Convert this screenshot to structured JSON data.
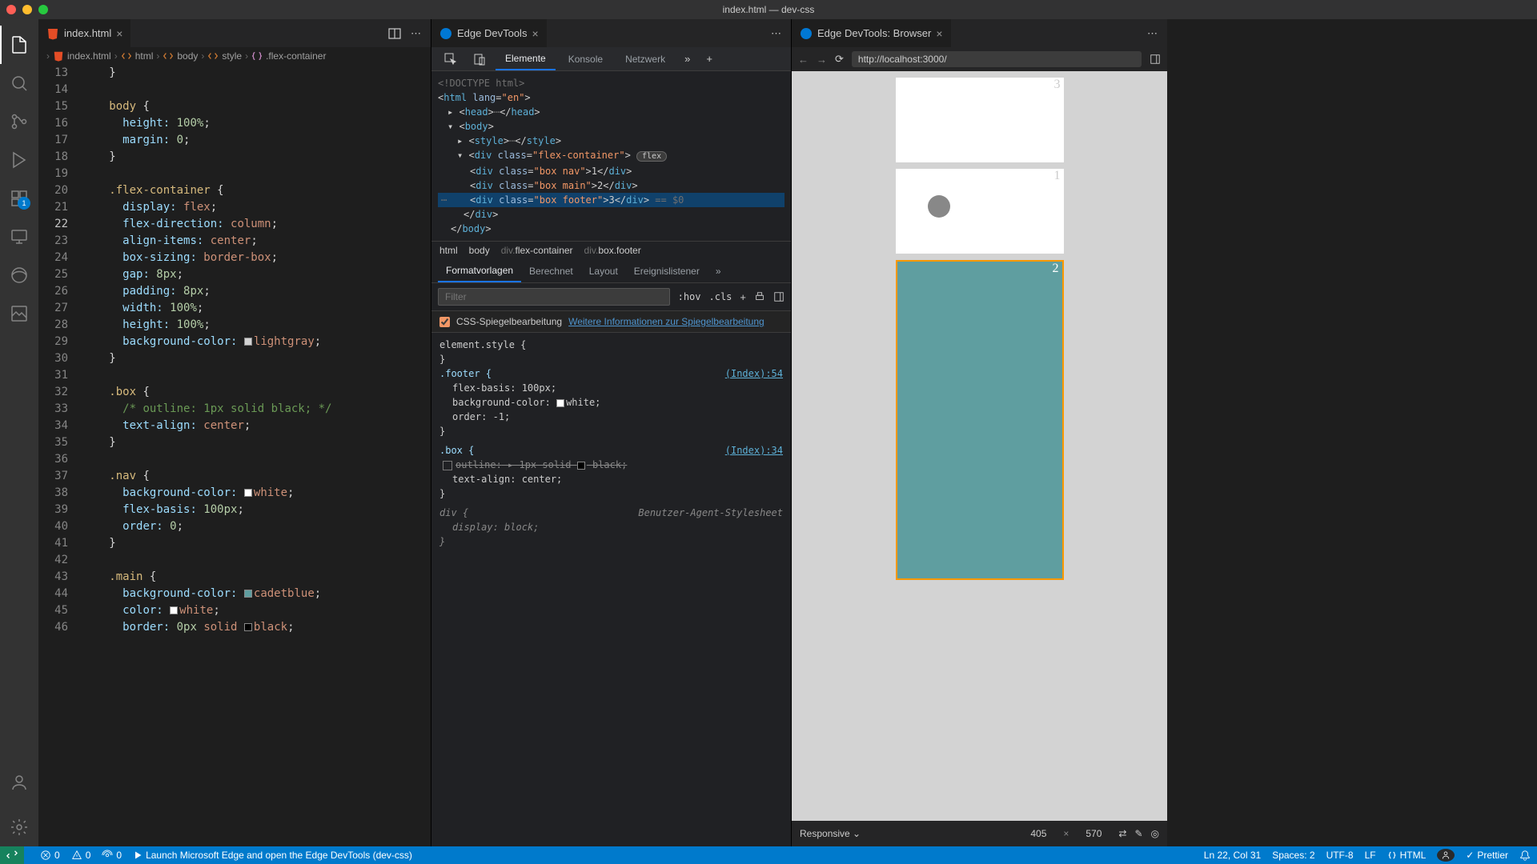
{
  "window_title": "index.html — dev-css",
  "editor": {
    "tab": {
      "name": "index.html"
    },
    "breadcrumbs": [
      "index.html",
      "html",
      "body",
      "style",
      ".flex-container"
    ],
    "line_numbers": [
      "13",
      "14",
      "15",
      "16",
      "17",
      "18",
      "19",
      "20",
      "21",
      "22",
      "23",
      "24",
      "25",
      "26",
      "27",
      "28",
      "29",
      "30",
      "31",
      "32",
      "33",
      "34",
      "35",
      "36",
      "37",
      "38",
      "39",
      "40",
      "41",
      "42",
      "43",
      "44",
      "45",
      "46"
    ],
    "highlighted_line": "22"
  },
  "code": {
    "l13": "}",
    "l15_sel": "body",
    "l15_brace": " {",
    "l16_p": "height:",
    "l16_v": " 100%",
    "l16_sc": ";",
    "l17_p": "margin:",
    "l17_v": " 0",
    "l17_sc": ";",
    "l18": "}",
    "l20_sel": ".flex-container",
    "l20_brace": " {",
    "l21_p": "display:",
    "l21_v": " flex",
    "l21_sc": ";",
    "l22_p": "flex-direction:",
    "l22_v": " column",
    "l22_sc": ";",
    "l23_p": "align-items:",
    "l23_v": " center",
    "l23_sc": ";",
    "l24_p": "box-sizing:",
    "l24_v": " border-box",
    "l24_sc": ";",
    "l25_p": "gap:",
    "l25_v": " 8px",
    "l25_sc": ";",
    "l26_p": "padding:",
    "l26_v": " 8px",
    "l26_sc": ";",
    "l27_p": "width:",
    "l27_v": " 100%",
    "l27_sc": ";",
    "l28_p": "height:",
    "l28_v": " 100%",
    "l28_sc": ";",
    "l29_p": "background-color:",
    "l29_v": "lightgray",
    "l29_sc": ";",
    "l30": "}",
    "l32_sel": ".box",
    "l32_brace": " {",
    "l33_c": "/* outline: 1px solid black; */",
    "l34_p": "text-align:",
    "l34_v": " center",
    "l34_sc": ";",
    "l35": "}",
    "l37_sel": ".nav",
    "l37_brace": " {",
    "l38_p": "background-color:",
    "l38_v": "white",
    "l38_sc": ";",
    "l39_p": "flex-basis:",
    "l39_v": " 100px",
    "l39_sc": ";",
    "l40_p": "order:",
    "l40_v": " 0",
    "l40_sc": ";",
    "l41": "}",
    "l43_sel": ".main",
    "l43_brace": " {",
    "l44_p": "background-color:",
    "l44_v": "cadetblue",
    "l44_sc": ";",
    "l45_p": "color:",
    "l45_v": "white",
    "l45_sc": ";",
    "l46_p": "border:",
    "l46_v1": " 0px",
    "l46_v2": " solid",
    "l46_v3": "black",
    "l46_sc": ";"
  },
  "devtools": {
    "tab_title": "Edge DevTools",
    "main_tabs": {
      "elements": "Elemente",
      "console": "Konsole",
      "network": "Netzwerk"
    },
    "dom": {
      "doctype": "<!DOCTYPE html>",
      "flex_badge": "flex",
      "eq0": "== $0",
      "box1": "1",
      "box2": "2",
      "box3": "3"
    },
    "dom_breadcrumb": {
      "html": "html",
      "body": "body",
      "div1_pre": "div.",
      "div1_main": "flex-container",
      "div2_pre": "div.",
      "div2_main": "box.footer"
    },
    "styles_tabs": {
      "styles": "Formatvorlagen",
      "computed": "Berechnet",
      "layout": "Layout",
      "listeners": "Ereignislistener"
    },
    "filter_placeholder": "Filter",
    "hov": ":hov",
    "cls": ".cls",
    "mirror": {
      "label": "CSS-Spiegelbearbeitung",
      "link": "Weitere Informationen zur Spiegelbearbeitung"
    },
    "rules": {
      "elstyle": "element.style {",
      "elstyle_close": "}",
      "footer_sel": ".footer {",
      "footer_ref": "(Index):54",
      "footer_p1": "flex-basis:",
      "footer_v1": " 100px;",
      "footer_p2": "background-color:",
      "footer_v2": "white;",
      "footer_p3": "order:",
      "footer_v3": " -1;",
      "footer_close": "}",
      "box_sel": ".box {",
      "box_ref": "(Index):34",
      "box_p1": "outline:",
      "box_v1a": "1px solid",
      "box_v1b": "black;",
      "box_p2": "text-align:",
      "box_v2": " center;",
      "box_close": "}",
      "div_sel": "div {",
      "div_ua": "Benutzer-Agent-Stylesheet",
      "div_p1": "display:",
      "div_v1": " block;",
      "div_close": "}"
    }
  },
  "browser": {
    "tab_title": "Edge DevTools: Browser",
    "url": "http://localhost:3000/",
    "boxes": {
      "b3": "3",
      "b1": "1",
      "b2": "2"
    },
    "device": "Responsive",
    "width": "405",
    "height": "570"
  },
  "activity_badge": "1",
  "statusbar": {
    "errors": "0",
    "warnings": "0",
    "port": "0",
    "launch": "Launch Microsoft Edge and open the Edge DevTools (dev-css)",
    "line_col": "Ln 22, Col 31",
    "spaces": "Spaces: 2",
    "encoding": "UTF-8",
    "eol": "LF",
    "lang": "HTML",
    "prettier": "Prettier"
  }
}
